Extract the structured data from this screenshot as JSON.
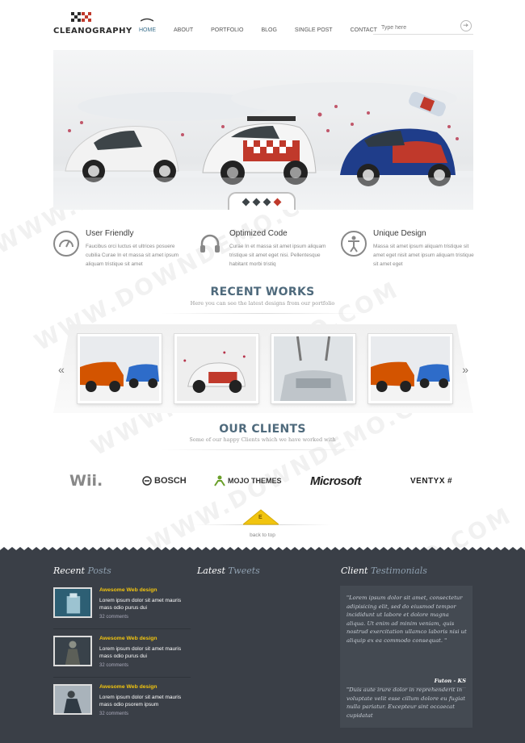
{
  "brand": {
    "name": "CLEANOGRAPHY"
  },
  "nav": {
    "items": [
      {
        "label": "HOME",
        "active": true
      },
      {
        "label": "ABOUT"
      },
      {
        "label": "PORTFOLIO"
      },
      {
        "label": "BLOG"
      },
      {
        "label": "SINGLE POST"
      },
      {
        "label": "CONTACT"
      }
    ]
  },
  "search": {
    "placeholder": "Type here"
  },
  "features": [
    {
      "icon": "speedometer-icon",
      "title": "User Friendly",
      "text": "Faucibus orci luctus et ultrices posuere cubilia Curae In et massa sit amet ipsum aliquam tristique sit amet"
    },
    {
      "icon": "headphones-icon",
      "title": "Optimized Code",
      "text": "Curae In et massa sit amet ipsum aliquam tristique sit amet eget nisi. Pellentesque habitant morbi tristiq"
    },
    {
      "icon": "accessibility-icon",
      "title": "Unique Design",
      "text": "Massa sit amet ipsum aliquam tristique sit amet eget nisit amet ipsum aliquam tristique sit amet eget"
    }
  ],
  "recent_works": {
    "title": "RECENT WORKS",
    "subtitle": "Here you can see the latest designs from our portfolio",
    "prev": "«",
    "next": "»"
  },
  "clients": {
    "title": "OUR CLIENTS",
    "subtitle": "Some of our happy Clients which we have worked with",
    "logos": [
      "Wii.",
      "BOSCH",
      "MOJO THEMES",
      "Microsoft",
      "VENTYX"
    ]
  },
  "back_to_top": {
    "label": "back to top",
    "badge": "E"
  },
  "footer": {
    "recent_posts": {
      "heading_a": "Recent",
      "heading_b": "Posts",
      "posts": [
        {
          "title": "Awesome Web design",
          "text": "Lorem ipsum dolor sit amet mauris mass odio purus dui",
          "meta": "32 comments"
        },
        {
          "title": "Awesome Web design",
          "text": "Lorem ipsum dolor sit amet mauris mass odio purus dui",
          "meta": "32 comments"
        },
        {
          "title": "Awesome Web design",
          "text": "Lorem ipsum dolor sit amet mauris mass odio psorem ipsum",
          "meta": "32 comments"
        }
      ]
    },
    "latest_tweets": {
      "heading_a": "Latest",
      "heading_b": "Tweets"
    },
    "testimonials": {
      "heading_a": "Client",
      "heading_b": "Testimonials",
      "quote1": "\"Lorem ipsum dolor sit amet, consectetur adipisicing elit, sed do eiusmod tempor incididunt ut labore et dolore magna aliqua. Ut enim ad minim veniam, quis nostrud exercitation ullamco laboris nisi ut aliquip ex ea commodo consequat. \"",
      "author": "Futon - KS",
      "quote2": "\"Duis aute irure dolor in reprehenderit in voluptate velit esse cillum dolore eu fugiat nulla pariatur. Excepteur sint occaecat cupidatat"
    }
  },
  "watermark": "WWW.DOWNDEMO.COM",
  "colors": {
    "accent": "#3a6f8c",
    "footer_bg": "#3a3f47",
    "post_title": "#f1c40f",
    "section_title": "#4f6a7c"
  }
}
